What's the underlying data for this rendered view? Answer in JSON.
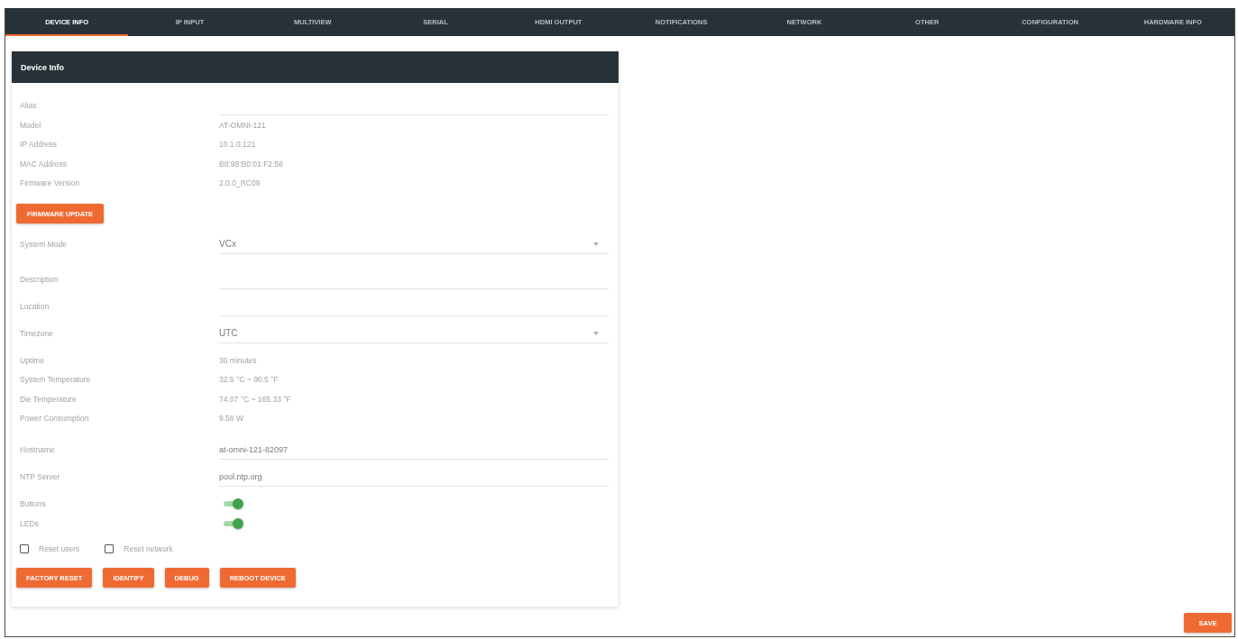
{
  "tabs": [
    {
      "label": "DEVICE INFO",
      "selected": true
    },
    {
      "label": "IP INPUT",
      "selected": false
    },
    {
      "label": "MULTIVIEW",
      "selected": false
    },
    {
      "label": "SERIAL",
      "selected": false
    },
    {
      "label": "HDMI OUTPUT",
      "selected": false
    },
    {
      "label": "NOTIFICATIONS",
      "selected": false
    },
    {
      "label": "NETWORK",
      "selected": false
    },
    {
      "label": "OTHER",
      "selected": false
    },
    {
      "label": "CONFIGURATION",
      "selected": false
    },
    {
      "label": "HARDWARE INFO",
      "selected": false
    }
  ],
  "card": {
    "title": "Device Info",
    "identity_fields": [
      {
        "kind": "input",
        "label": "Alias"
      },
      {
        "kind": "text",
        "label": "Model",
        "value": "AT-OMNI-121"
      },
      {
        "kind": "text",
        "label": "IP Address",
        "value": "10.1.0.121"
      },
      {
        "kind": "text",
        "label": "MAC Address",
        "value": "B8:98:B0:01:F2:56"
      },
      {
        "kind": "text",
        "label": "Firmware Version",
        "value": "2.0.0_RC09"
      }
    ],
    "firmware_button": "FIRMWARE UPDATE",
    "settings_fields": [
      {
        "kind": "select",
        "label": "System Mode",
        "value": "VCx"
      },
      {
        "kind": "input",
        "label": "Description"
      },
      {
        "kind": "input",
        "label": "Location"
      },
      {
        "kind": "select",
        "label": "Timezone",
        "value": "UTC"
      },
      {
        "kind": "text",
        "label": "Uptime",
        "value": "36 minutes"
      },
      {
        "kind": "text",
        "label": "System Temperature",
        "value": "32.5 °C ~ 90.5 °F"
      },
      {
        "kind": "text",
        "label": "Die Temperature",
        "value": "74.07 °C ~ 165.33 °F"
      },
      {
        "kind": "text",
        "label": "Power Consumption",
        "value": "9.56 W"
      },
      {
        "kind": "input",
        "label": "Hostname",
        "value": "at-omni-121-82097"
      },
      {
        "kind": "input",
        "label": "NTP Server",
        "value": "pool.ntp.org"
      },
      {
        "kind": "toggle",
        "label": "Buttons",
        "on": true
      },
      {
        "kind": "toggle",
        "label": "LEDs",
        "on": true
      }
    ],
    "checkboxes": [
      {
        "label": "Reset users",
        "checked": false
      },
      {
        "label": "Reset network",
        "checked": false
      }
    ],
    "actions": [
      "FACTORY RESET",
      "IDENTIFY",
      "DEBUG",
      "REBOOT DEVICE"
    ]
  },
  "save_button": "SAVE"
}
